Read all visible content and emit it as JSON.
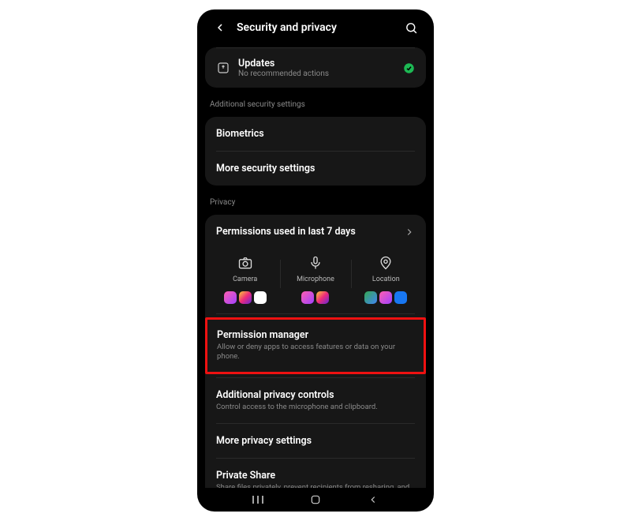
{
  "header": {
    "title": "Security and privacy"
  },
  "updates": {
    "title": "Updates",
    "subtitle": "No recommended actions"
  },
  "section1": {
    "label": "Additional security settings"
  },
  "biometrics": {
    "title": "Biometrics"
  },
  "more_security": {
    "title": "More security settings"
  },
  "section2": {
    "label": "Privacy"
  },
  "perm_used": {
    "title": "Permissions used in last 7 days"
  },
  "perm_cols": {
    "camera": "Camera",
    "microphone": "Microphone",
    "location": "Location"
  },
  "perm_manager": {
    "title": "Permission manager",
    "subtitle": "Allow or deny apps to access features or data on your phone."
  },
  "add_privacy": {
    "title": "Additional privacy controls",
    "subtitle": "Control access to the microphone and clipboard."
  },
  "more_privacy": {
    "title": "More privacy settings"
  },
  "private_share": {
    "title": "Private Share",
    "subtitle": "Share files privately, prevent recipients from resharing, and set expiry dates."
  },
  "app_colors": {
    "messenger": "linear-gradient(135deg,#ff5fb0,#a040ff)",
    "instagram": "linear-gradient(135deg,#f9ce34,#ee2a7b,#6228d7)",
    "google": "#fff",
    "maps": "linear-gradient(135deg,#34a853,#4285f4)",
    "facebook": "#1877f2"
  }
}
